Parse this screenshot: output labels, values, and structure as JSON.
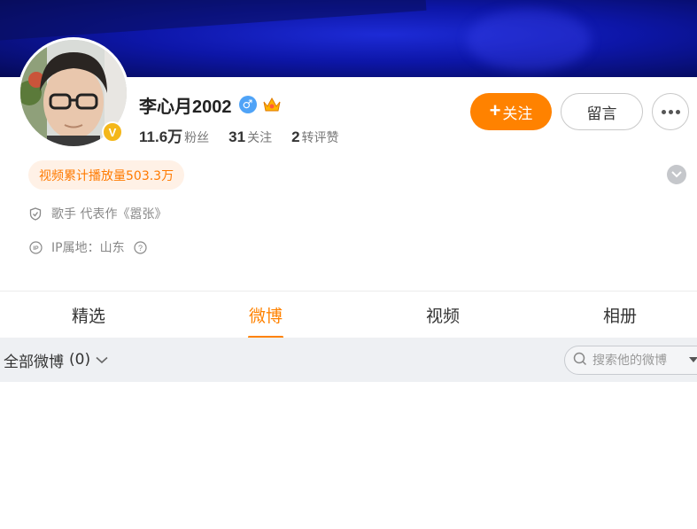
{
  "profile": {
    "name": "李心月2002",
    "gender_symbol": "♂",
    "verified_badge": "V",
    "stats": [
      {
        "num": "11.6万",
        "label": "粉丝"
      },
      {
        "num": "31",
        "label": "关注"
      },
      {
        "num": "2",
        "label": "转评赞"
      }
    ],
    "tag": "视频累计播放量503.3万",
    "info": [
      {
        "icon": "shield-icon",
        "text": "歌手 代表作《嚣张》"
      },
      {
        "icon": "ip-icon",
        "text": "IP属地：山东"
      }
    ]
  },
  "actions": {
    "follow_plus": "+",
    "follow_label": "关注",
    "message_label": "留言"
  },
  "tabs": [
    {
      "label": "精选",
      "active": false
    },
    {
      "label": "微博",
      "active": true
    },
    {
      "label": "视频",
      "active": false
    },
    {
      "label": "相册",
      "active": false
    }
  ],
  "filter": {
    "label": "全部微博",
    "count": "(0)",
    "search_placeholder": "搜索他的微博"
  },
  "colors": {
    "accent": "#ff8200",
    "cover": "#0d16a8",
    "tag_bg": "#fff1e6",
    "badge": "#f4b71a",
    "gender": "#4fa3f7"
  }
}
